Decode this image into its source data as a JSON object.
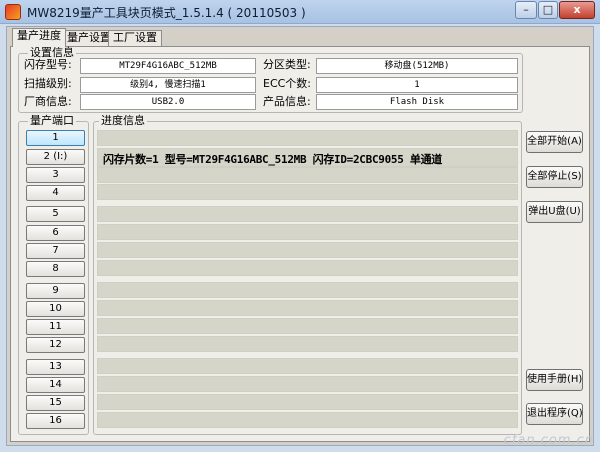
{
  "window": {
    "title": "MW8219量产工具块页模式_1.5.1.4 ( 20110503 )",
    "minimize": "–",
    "maximize": "□",
    "close": "x"
  },
  "tabs": [
    "量产进度",
    "量产设置",
    "工厂设置"
  ],
  "settings": {
    "group_title": "设置信息",
    "flash_type_label": "闪存型号:",
    "flash_type_value": "MT29F4G16ABC_512MB",
    "partition_label": "分区类型:",
    "partition_value": "移动盘(512MB)",
    "scan_level_label": "扫描级别:",
    "scan_level_value": "级别4, 慢速扫描1",
    "ecc_label": "ECC个数:",
    "ecc_value": "1",
    "vendor_label": "厂商信息:",
    "vendor_value": "USB2.0",
    "product_label": "产品信息:",
    "product_value": "Flash Disk"
  },
  "ports": {
    "group_title": "量产端口",
    "items": [
      "1",
      "2 (I:)",
      "3",
      "4",
      "5",
      "6",
      "7",
      "8",
      "9",
      "10",
      "11",
      "12",
      "13",
      "14",
      "15",
      "16"
    ]
  },
  "progress": {
    "group_title": "进度信息",
    "row2_text": "闪存片数=1 型号=MT29F4G16ABC_512MB 闪存ID=2CBC9055 单通道"
  },
  "buttons": {
    "start_all": "全部开始(A)",
    "stop_all": "全部停止(S)",
    "eject_u": "弹出U盘(U)",
    "manual": "使用手册(H)",
    "exit": "退出程序(Q)"
  },
  "watermark": "cfan.com.cn"
}
